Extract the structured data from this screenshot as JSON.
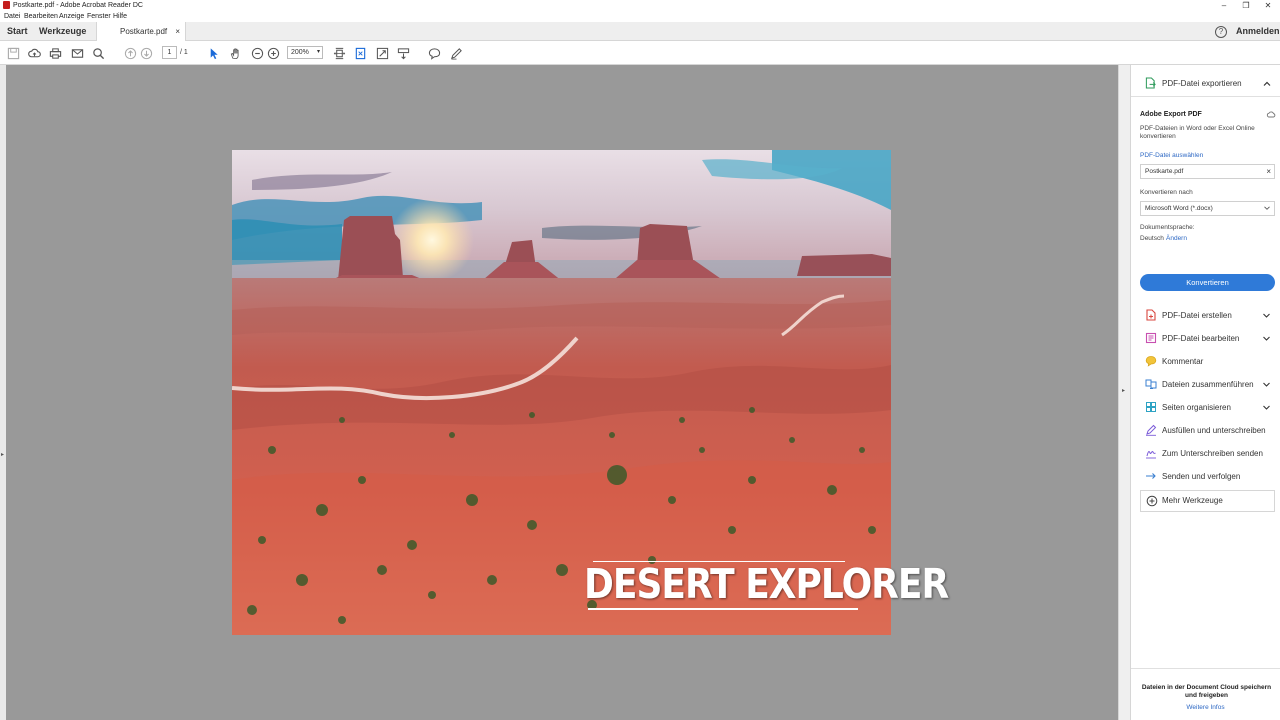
{
  "window": {
    "title": "Postkarte.pdf - Adobe Acrobat Reader DC",
    "controls": {
      "minimize": "–",
      "restore": "❐",
      "close": "✕"
    }
  },
  "menu": [
    "Datei",
    "Bearbeiten",
    "Anzeige",
    "Fenster",
    "Hilfe"
  ],
  "tabs": {
    "start": "Start",
    "tools": "Werkzeuge",
    "document": "Postkarte.pdf",
    "document_close": "×",
    "help": "?",
    "signin": "Anmelden"
  },
  "toolbar": {
    "page_current": "1",
    "page_total": "/ 1",
    "zoom": "200%",
    "zoom_caret": "▾"
  },
  "document": {
    "postcard_title": "DESERT EXPLORER"
  },
  "side_panel": {
    "export_header": "PDF-Datei exportieren",
    "export_title": "Adobe Export PDF",
    "export_desc": "PDF-Dateien in Word oder Excel Online konvertieren",
    "select_file_link": "PDF-Datei auswählen",
    "file_name": "Postkarte.pdf",
    "file_clear": "×",
    "convert_to_label": "Konvertieren nach",
    "convert_to_value": "Microsoft Word (*.docx)",
    "doc_language_label": "Dokumentsprache:",
    "doc_language_value": "Deutsch",
    "change_link": "Ändern",
    "convert_button": "Konvertieren",
    "tools": [
      {
        "label": "PDF-Datei erstellen",
        "icon": "create-pdf-icon"
      },
      {
        "label": "PDF-Datei bearbeiten",
        "icon": "edit-pdf-icon"
      },
      {
        "label": "Kommentar",
        "icon": "comment-icon"
      },
      {
        "label": "Dateien zusammenführen",
        "icon": "combine-files-icon"
      },
      {
        "label": "Seiten organisieren",
        "icon": "organize-pages-icon"
      },
      {
        "label": "Ausfüllen und unterschreiben",
        "icon": "fill-sign-icon"
      },
      {
        "label": "Zum Unterschreiben senden",
        "icon": "send-for-signature-icon"
      },
      {
        "label": "Senden und verfolgen",
        "icon": "send-track-icon"
      }
    ],
    "more_tools": "Mehr Werkzeuge",
    "footer_text": "Dateien in der Document Cloud speichern und freigeben",
    "footer_link": "Weitere Infos"
  },
  "colors": {
    "accent": "#2f7ad8",
    "link": "#2d68c4",
    "workspace": "#999999"
  }
}
